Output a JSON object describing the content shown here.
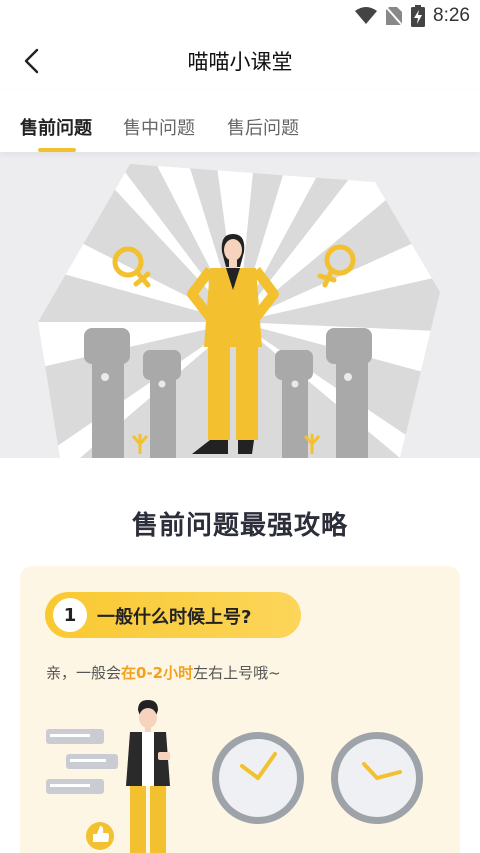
{
  "status": {
    "time": "8:26"
  },
  "nav": {
    "title": "喵喵小课堂"
  },
  "tabs": [
    {
      "label": "售前问题"
    },
    {
      "label": "售中问题"
    },
    {
      "label": "售后问题"
    }
  ],
  "section": {
    "title": "售前问题最强攻略"
  },
  "qa": {
    "number": "1",
    "question": "一般什么时候上号?",
    "answer_prefix": "亲，一般会",
    "answer_highlight": "在0-2小时",
    "answer_suffix": "左右上号哦~"
  },
  "colors": {
    "accent": "#F3C12F",
    "highlight": "#F2A21C",
    "card_bg": "#FEF6E4",
    "hero_bg": "#EDEDF0"
  }
}
